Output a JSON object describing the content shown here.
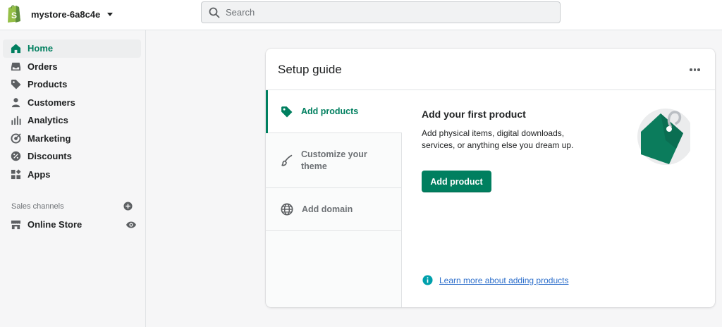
{
  "topbar": {
    "store_name": "mystore-6a8c4e",
    "search_placeholder": "Search"
  },
  "sidebar": {
    "items": [
      {
        "label": "Home",
        "icon": "home-icon",
        "active": true
      },
      {
        "label": "Orders",
        "icon": "inbox-icon"
      },
      {
        "label": "Products",
        "icon": "tag-icon"
      },
      {
        "label": "Customers",
        "icon": "person-icon"
      },
      {
        "label": "Analytics",
        "icon": "bar-chart-icon"
      },
      {
        "label": "Marketing",
        "icon": "target-icon"
      },
      {
        "label": "Discounts",
        "icon": "percent-icon"
      },
      {
        "label": "Apps",
        "icon": "grid-icon"
      }
    ],
    "sales_channels_label": "Sales channels",
    "online_store_label": "Online Store"
  },
  "setup_guide": {
    "title": "Setup guide",
    "tabs": [
      {
        "label": "Add products",
        "icon": "tag-icon",
        "active": true
      },
      {
        "label": "Customize your theme",
        "icon": "paintbrush-icon"
      },
      {
        "label": "Add domain",
        "icon": "globe-icon"
      }
    ],
    "content": {
      "title": "Add your first product",
      "description": "Add physical items, digital downloads, services, or anything else you dream up.",
      "button_label": "Add product",
      "learn_more_link": "Learn more about adding products"
    }
  },
  "colors": {
    "accent": "#007f5f",
    "link": "#2c6ecb",
    "background": "#f6f6f7"
  }
}
